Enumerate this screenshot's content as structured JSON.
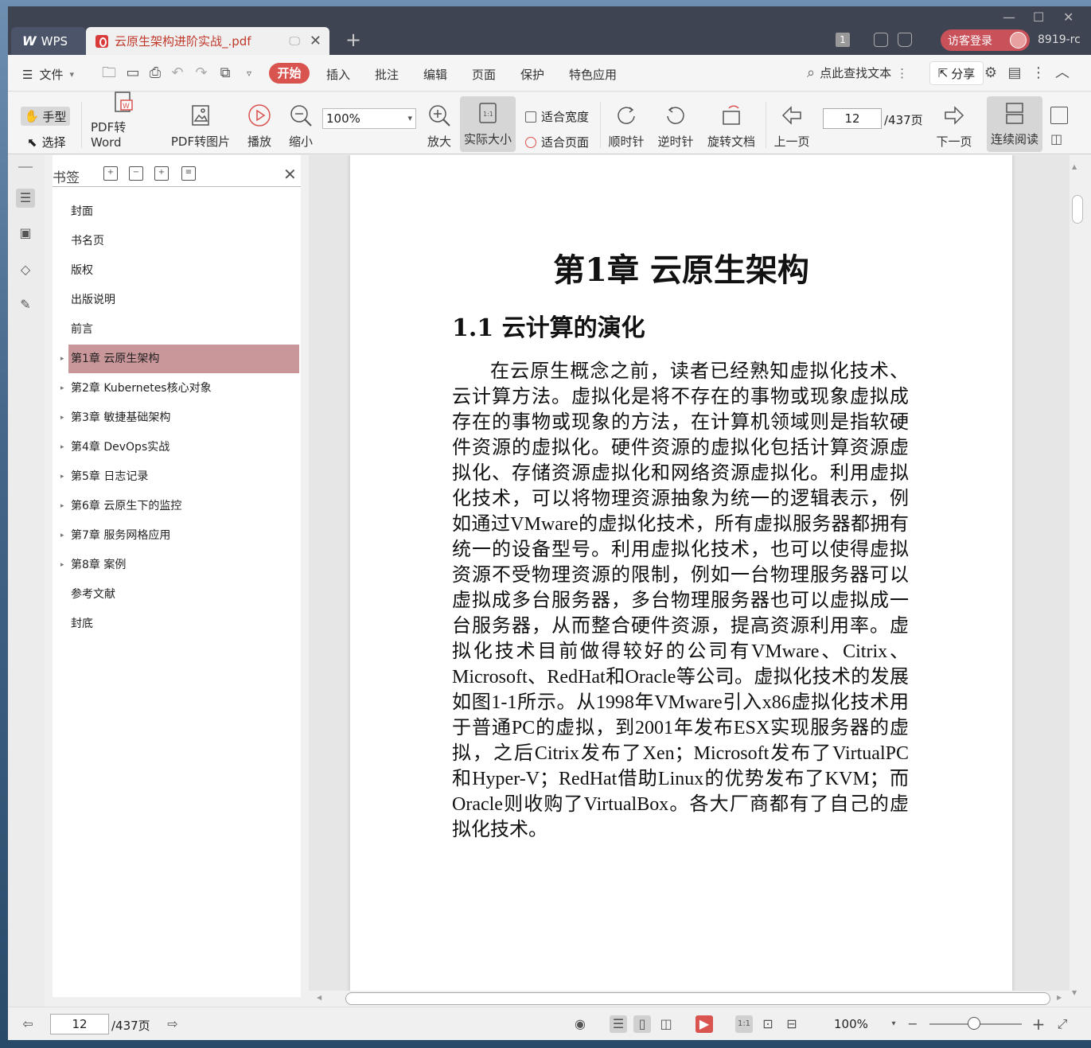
{
  "titlebar": {
    "app_tab": "WPS",
    "doc_tab": "云原生架构进阶实战_.pdf",
    "badge_num": "1",
    "login_label": "访客登录",
    "user_id": "8919-rc"
  },
  "menu": {
    "file": "文件",
    "tabs": [
      "开始",
      "插入",
      "批注",
      "编辑",
      "页面",
      "保护",
      "特色应用"
    ],
    "search": "点此查找文本",
    "share": "分享"
  },
  "toolbar": {
    "hand": "手型",
    "select": "选择",
    "pdf_word": "PDF转Word",
    "pdf_img": "PDF转图片",
    "play": "播放",
    "zoom_out": "缩小",
    "zoom_value": "100%",
    "zoom_in": "放大",
    "actual_size": "实际大小",
    "fit_width": "适合宽度",
    "fit_page": "适合页面",
    "cw": "顺时针",
    "ccw": "逆时针",
    "rotate_doc": "旋转文档",
    "prev_page": "上一页",
    "page_current": "12",
    "page_total": "/437页",
    "next_page": "下一页",
    "continuous": "连续阅读"
  },
  "bookmarks": {
    "title": "书签",
    "items": [
      {
        "label": "封面",
        "expandable": false
      },
      {
        "label": "书名页",
        "expandable": false
      },
      {
        "label": "版权",
        "expandable": false
      },
      {
        "label": "出版说明",
        "expandable": false
      },
      {
        "label": "前言",
        "expandable": false
      },
      {
        "label": "第1章 云原生架构",
        "expandable": true,
        "selected": true
      },
      {
        "label": "第2章 Kubernetes核心对象",
        "expandable": true
      },
      {
        "label": "第3章 敏捷基础架构",
        "expandable": true
      },
      {
        "label": "第4章 DevOps实战",
        "expandable": true
      },
      {
        "label": "第5章 日志记录",
        "expandable": true
      },
      {
        "label": "第6章 云原生下的监控",
        "expandable": true
      },
      {
        "label": "第7章 服务网格应用",
        "expandable": true
      },
      {
        "label": "第8章 案例",
        "expandable": true
      },
      {
        "label": "参考文献",
        "expandable": false
      },
      {
        "label": "封底",
        "expandable": false
      }
    ]
  },
  "document": {
    "chapter_title": "第1章 云原生架构",
    "section_title": "1.1 云计算的演化",
    "paragraph": "在云原生概念之前，读者已经熟知虚拟化技术、云计算方法。虚拟化是将不存在的事物或现象虚拟成存在的事物或现象的方法，在计算机领域则是指软硬件资源的虚拟化。硬件资源的虚拟化包括计算资源虚拟化、存储资源虚拟化和网络资源虚拟化。利用虚拟化技术，可以将物理资源抽象为统一的逻辑表示，例如通过VMware的虚拟化技术，所有虚拟服务器都拥有统一的设备型号。利用虚拟化技术，也可以使得虚拟资源不受物理资源的限制，例如一台物理服务器可以虚拟成多台服务器，多台物理服务器也可以虚拟成一台服务器，从而整合硬件资源，提高资源利用率。虚拟化技术目前做得较好的公司有VMware、Citrix、Microsoft、RedHat和Oracle等公司。虚拟化技术的发展如图1-1所示。从1998年VMware引入x86虚拟化技术用于普通PC的虚拟，到2001年发布ESX实现服务器的虚拟，之后Citrix发布了Xen；Microsoft发布了VirtualPC和Hyper-V；RedHat借助Linux的优势发布了KVM；而Oracle则收购了VirtualBox。各大厂商都有了自己的虚拟化技术。"
  },
  "statusbar": {
    "page_current": "12",
    "page_total": "/437页",
    "zoom": "100%"
  },
  "colors": {
    "accent": "#d9534f",
    "selected_bookmark": "#c9969a",
    "titlebar": "#3f4452"
  }
}
